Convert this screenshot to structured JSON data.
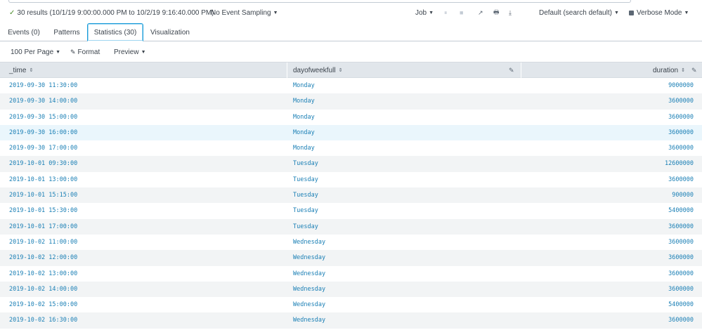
{
  "status": {
    "results_text": "30 results (10/1/19 9:00:00.000 PM to 10/2/19 9:16:40.000 PM)",
    "sampling": "No Event Sampling",
    "job": "Job",
    "search_mode": "Default (search default)",
    "verbose": "Verbose Mode"
  },
  "icons": {
    "check": "✓",
    "pause": "⏸",
    "stop": "■",
    "share": "↗",
    "print": "🖶",
    "export": "⤓",
    "caret": "▼",
    "sort": "⇕",
    "pencil": "✎"
  },
  "tabs": [
    {
      "label": "Events (0)"
    },
    {
      "label": "Patterns"
    },
    {
      "label": "Statistics (30)"
    },
    {
      "label": "Visualization"
    }
  ],
  "controls": {
    "per_page": "100 Per Page",
    "format": "Format",
    "preview": "Preview"
  },
  "table": {
    "columns": [
      "_time",
      "dayofweekfull",
      "duration"
    ],
    "rows": [
      [
        "2019-09-30 11:30:00",
        "Monday",
        "9000000"
      ],
      [
        "2019-09-30 14:00:00",
        "Monday",
        "3600000"
      ],
      [
        "2019-09-30 15:00:00",
        "Monday",
        "3600000"
      ],
      [
        "2019-09-30 16:00:00",
        "Monday",
        "3600000"
      ],
      [
        "2019-09-30 17:00:00",
        "Monday",
        "3600000"
      ],
      [
        "2019-10-01 09:30:00",
        "Tuesday",
        "12600000"
      ],
      [
        "2019-10-01 13:00:00",
        "Tuesday",
        "3600000"
      ],
      [
        "2019-10-01 15:15:00",
        "Tuesday",
        "900000"
      ],
      [
        "2019-10-01 15:30:00",
        "Tuesday",
        "5400000"
      ],
      [
        "2019-10-01 17:00:00",
        "Tuesday",
        "3600000"
      ],
      [
        "2019-10-02 11:00:00",
        "Wednesday",
        "3600000"
      ],
      [
        "2019-10-02 12:00:00",
        "Wednesday",
        "3600000"
      ],
      [
        "2019-10-02 13:00:00",
        "Wednesday",
        "3600000"
      ],
      [
        "2019-10-02 14:00:00",
        "Wednesday",
        "3600000"
      ],
      [
        "2019-10-02 15:00:00",
        "Wednesday",
        "5400000"
      ],
      [
        "2019-10-02 16:30:00",
        "Wednesday",
        "3600000"
      ]
    ]
  },
  "colors": {
    "link": "#1a7fb5",
    "active_tab_border": "#1a9cd9",
    "header_bg": "#e1e6eb",
    "alt_row": "#f2f4f5",
    "hover_row": "#eaf6fc",
    "success": "#4a8c2a"
  }
}
